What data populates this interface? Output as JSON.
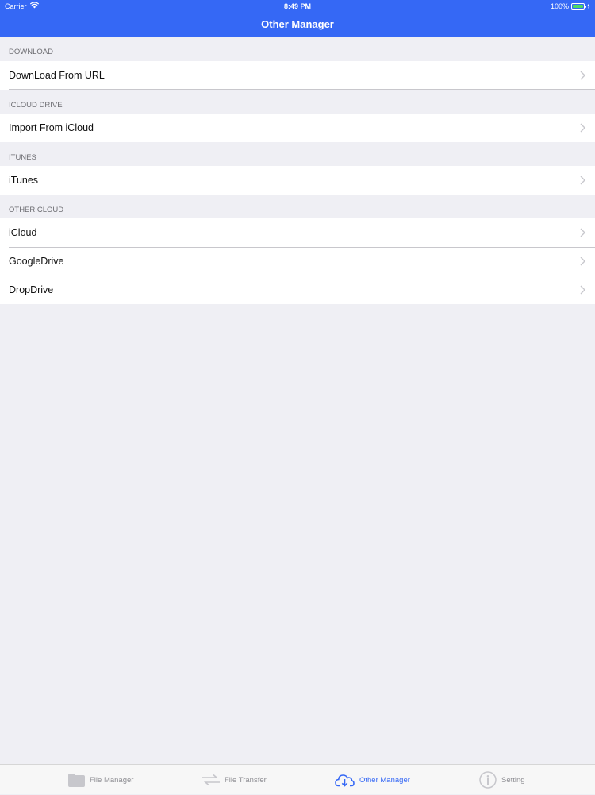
{
  "status_bar": {
    "carrier": "Carrier",
    "time": "8:49 PM",
    "battery": "100%"
  },
  "nav": {
    "title": "Other Manager"
  },
  "sections": [
    {
      "header": "DOWNLOAD",
      "items": [
        {
          "label": "DownLoad From URL"
        }
      ]
    },
    {
      "header": "ICLOUD DRIVE",
      "items": [
        {
          "label": "Import From iCloud"
        }
      ]
    },
    {
      "header": "ITUNES",
      "items": [
        {
          "label": "iTunes"
        }
      ]
    },
    {
      "header": "OTHER CLOUD",
      "items": [
        {
          "label": "iCloud"
        },
        {
          "label": "GoogleDrive"
        },
        {
          "label": "DropDrive"
        }
      ]
    }
  ],
  "tabbar": {
    "tabs": [
      {
        "label": "File Manager",
        "icon": "folder-icon",
        "active": false
      },
      {
        "label": "File Transfer",
        "icon": "transfer-icon",
        "active": false
      },
      {
        "label": "Other Manager",
        "icon": "cloud-download-icon",
        "active": true
      },
      {
        "label": "Setting",
        "icon": "info-icon",
        "active": false
      }
    ]
  },
  "colors": {
    "accent": "#3568f5",
    "background": "#efeff4",
    "inactive_tab": "#8e8e93",
    "battery": "#4cd964"
  }
}
